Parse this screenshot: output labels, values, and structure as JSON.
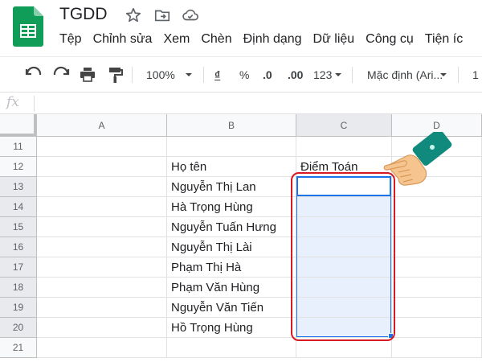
{
  "app": {
    "title": "TGDD",
    "icons": [
      "sheets-logo-icon",
      "star-icon",
      "move-to-folder-icon",
      "cloud-saved-icon"
    ]
  },
  "menu": [
    "Tệp",
    "Chỉnh sửa",
    "Xem",
    "Chèn",
    "Định dạng",
    "Dữ liệu",
    "Công cụ",
    "Tiện íc"
  ],
  "toolbar": {
    "zoom": "100%",
    "currency": "₫",
    "percent": "%",
    "decrease_decimal": ".0",
    "increase_decimal": ".00",
    "more_formats": "123",
    "font": "Mặc định (Ari...",
    "font_size": "1"
  },
  "formula": {
    "fx_label": "fx",
    "value": ""
  },
  "grid": {
    "columns": [
      "A",
      "B",
      "C",
      "D"
    ],
    "rows": [
      {
        "num": "11",
        "b": "",
        "c": ""
      },
      {
        "num": "12",
        "b": "Họ tên",
        "c": "Điểm Toán"
      },
      {
        "num": "13",
        "b": "Nguyễn Thị Lan",
        "c": ""
      },
      {
        "num": "14",
        "b": "Hà Trọng Hùng",
        "c": ""
      },
      {
        "num": "15",
        "b": "Nguyễn Tuấn Hưng",
        "c": ""
      },
      {
        "num": "16",
        "b": "Nguyễn Thị Lài",
        "c": ""
      },
      {
        "num": "17",
        "b": "Phạm Thị Hà",
        "c": ""
      },
      {
        "num": "18",
        "b": "Phạm Văn Hùng",
        "c": ""
      },
      {
        "num": "19",
        "b": "Nguyễn Văn Tiến",
        "c": ""
      },
      {
        "num": "20",
        "b": "Hồ Trọng Hùng",
        "c": ""
      },
      {
        "num": "21",
        "b": "",
        "c": ""
      }
    ]
  },
  "selection": {
    "range": "C13:C20",
    "highlight_color": "#d81b22",
    "accent_color": "#1a73e8"
  }
}
